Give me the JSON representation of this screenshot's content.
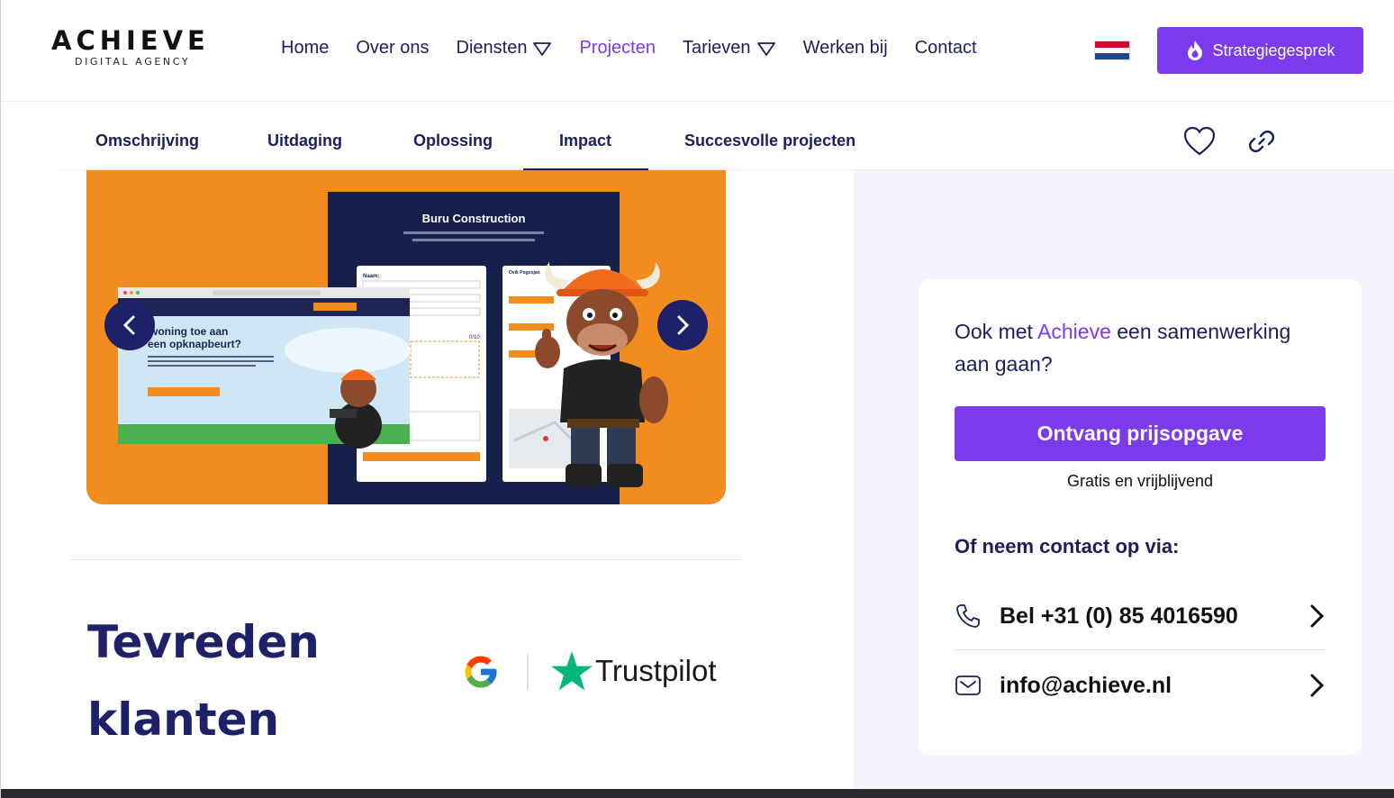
{
  "brand": {
    "name": "ACHIEVE",
    "tagline": "DIGITAL AGENCY"
  },
  "nav": {
    "items": [
      {
        "label": "Home",
        "dropdown": false,
        "active": false
      },
      {
        "label": "Over ons",
        "dropdown": false,
        "active": false
      },
      {
        "label": "Diensten",
        "dropdown": true,
        "active": false
      },
      {
        "label": "Projecten",
        "dropdown": false,
        "active": true
      },
      {
        "label": "Tarieven",
        "dropdown": true,
        "active": false
      },
      {
        "label": "Werken bij",
        "dropdown": false,
        "active": false
      },
      {
        "label": "Contact",
        "dropdown": false,
        "active": false
      }
    ],
    "language_icon": "netherlands-flag-icon",
    "cta_label": "Strategiegesprek",
    "cta_icon": "flame-icon"
  },
  "tabs": {
    "items": [
      "Omschrijving",
      "Uitdaging",
      "Oplossing",
      "Impact",
      "Succesvolle projecten"
    ],
    "active": "Impact",
    "icons": [
      "heart-icon",
      "link-icon"
    ]
  },
  "carousel": {
    "prev_icon": "chevron-left-icon",
    "next_icon": "chevron-right-icon",
    "slide_texts": {
      "company": "Buru Construction",
      "hero_line1": "s uw woning toe aan",
      "hero_line2": "een opknapbeurt?",
      "form_label": "Naam:",
      "counter": "0/10",
      "person": "Ovik Pogosjan"
    }
  },
  "reviews": {
    "title_line1": "Tevreden",
    "title_line2": "klanten",
    "logos": [
      "google-logo",
      "trustpilot-logo"
    ],
    "trustpilot_label": "Trustpilot"
  },
  "sidebar_card": {
    "heading_pre": "Ook met ",
    "heading_accent": "Achieve",
    "heading_post": " een samenwerking aan gaan?",
    "quote_button": "Ontvang prijsopgave",
    "quote_sub": "Gratis en vrijblijvend",
    "contact_heading": "Of neem contact op via:",
    "phone": "Bel +31 (0) 85 4016590",
    "email": "info@achieve.nl"
  },
  "colors": {
    "primary": "#7c3aed",
    "navy": "#1b1f5c",
    "slide_bg": "#f28c1e",
    "panel_bg": "#f5f3fd"
  }
}
